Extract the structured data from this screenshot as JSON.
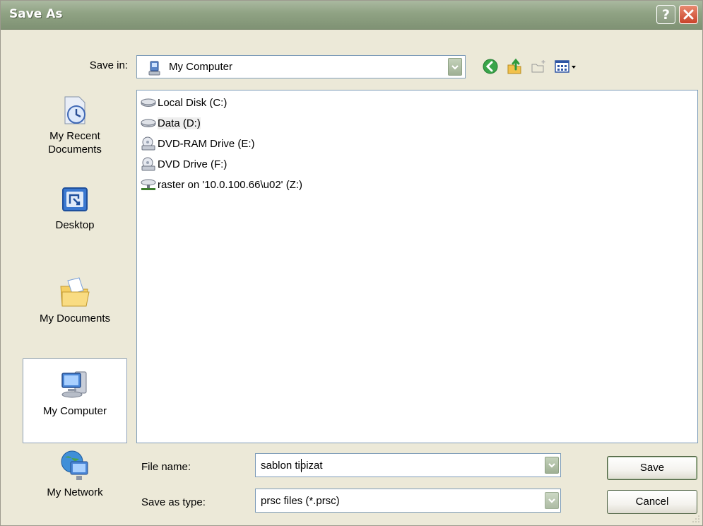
{
  "window": {
    "title": "Save As",
    "help_glyph": "?",
    "help_icon": "question-icon",
    "close_icon": "close-icon"
  },
  "save_in": {
    "label": "Save in:",
    "value": "My Computer",
    "icon": "my-computer-icon"
  },
  "toolbar": {
    "icons": [
      "back-icon",
      "up-folder-icon",
      "new-folder-icon",
      "view-menu-icon"
    ]
  },
  "places": [
    {
      "label_lines": [
        "My Recent",
        "Documents"
      ],
      "icon": "recent-documents-icon"
    },
    {
      "label_lines": [
        "Desktop"
      ],
      "icon": "desktop-icon"
    },
    {
      "label_lines": [
        "My Documents"
      ],
      "icon": "my-documents-icon"
    },
    {
      "label_lines": [
        "My Computer"
      ],
      "icon": "my-computer-icon",
      "selected": true
    },
    {
      "label_lines": [
        "My Network"
      ],
      "icon": "my-network-icon"
    }
  ],
  "files": [
    {
      "label": "Local Disk (C:)",
      "icon": "hard-disk-icon"
    },
    {
      "label": "Data (D:)",
      "icon": "hard-disk-icon",
      "focused": true
    },
    {
      "label": "DVD-RAM Drive (E:)",
      "icon": "dvd-drive-icon"
    },
    {
      "label": "DVD Drive (F:)",
      "icon": "dvd-drive-icon"
    },
    {
      "label": "raster on '10.0.100.66\\u02' (Z:)",
      "icon": "network-drive-icon"
    }
  ],
  "file_name": {
    "label": "File name:",
    "value": "sablon tipizat"
  },
  "save_as_type": {
    "label": "Save as type:",
    "value": "prsc files (*.prsc)"
  },
  "buttons": {
    "save": "Save",
    "cancel": "Cancel"
  },
  "colors": {
    "titlebar": "#8fa283",
    "dialog_bg": "#ece9d8",
    "field_border": "#7f9db9",
    "close_button": "#c9432a"
  }
}
